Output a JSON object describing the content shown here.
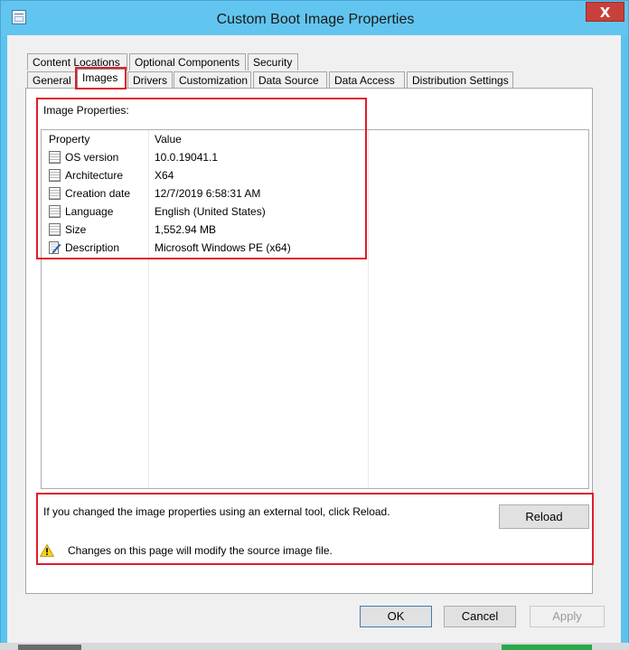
{
  "window": {
    "title": "Custom Boot Image Properties",
    "close_glyph": "X"
  },
  "tabs": {
    "row1": [
      "Content Locations",
      "Optional Components",
      "Security"
    ],
    "row2": [
      "General",
      "Images",
      "Drivers",
      "Customization",
      "Data Source",
      "Data Access",
      "Distribution Settings"
    ],
    "active": "Images"
  },
  "images_tab": {
    "section_label": "Image Properties:",
    "columns": [
      "Property",
      "Value"
    ],
    "rows": [
      {
        "property": "OS version",
        "value": "10.0.19041.1",
        "icon": "document-icon"
      },
      {
        "property": "Architecture",
        "value": "X64",
        "icon": "document-icon"
      },
      {
        "property": "Creation date",
        "value": "12/7/2019 6:58:31 AM",
        "icon": "document-icon"
      },
      {
        "property": "Language",
        "value": "English (United States)",
        "icon": "document-icon"
      },
      {
        "property": "Size",
        "value": "1,552.94 MB",
        "icon": "document-icon"
      },
      {
        "property": "Description",
        "value": "Microsoft Windows PE (x64)",
        "icon": "edit-document-icon"
      }
    ],
    "reload_message": "If you changed the image properties using an external tool, click Reload.",
    "reload_label": "Reload",
    "warning_text": "Changes on this page will modify the source image file."
  },
  "footer": {
    "ok_label": "OK",
    "cancel_label": "Cancel",
    "apply_label": "Apply"
  },
  "colors": {
    "title_bar": "#62c5ef",
    "close_button": "#c7413a",
    "highlight_box": "#e01d28"
  }
}
